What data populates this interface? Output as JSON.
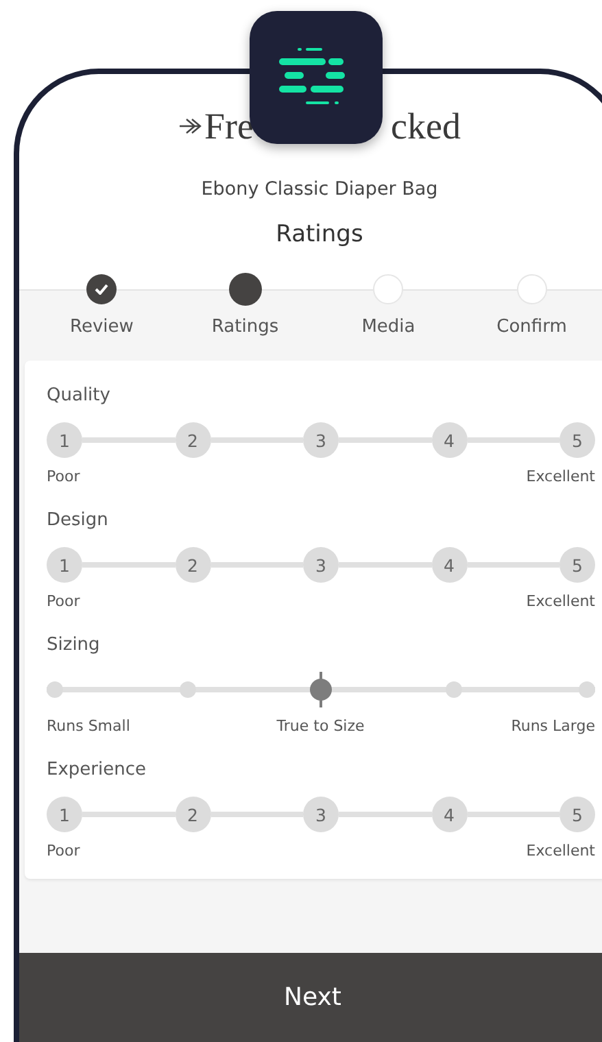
{
  "brand": {
    "parts": [
      "Fre",
      "cked"
    ]
  },
  "product": "Ebony Classic Diaper Bag",
  "heading": "Ratings",
  "steps": [
    {
      "label": "Review",
      "completed": true,
      "selected": false
    },
    {
      "label": "Ratings",
      "completed": false,
      "selected": true
    },
    {
      "label": "Media",
      "completed": false,
      "selected": false
    },
    {
      "label": "Confirm",
      "completed": false,
      "selected": false
    }
  ],
  "ratings": [
    {
      "kind": "numbered",
      "title": "Quality",
      "options": [
        {
          "label": "1",
          "selected": false
        },
        {
          "label": "2",
          "selected": false
        },
        {
          "label": "3",
          "selected": false
        },
        {
          "label": "4",
          "selected": false
        },
        {
          "label": "5",
          "selected": false
        }
      ],
      "low_label": "Poor",
      "high_label": "Excellent"
    },
    {
      "kind": "numbered",
      "title": "Design",
      "options": [
        {
          "label": "1",
          "selected": false
        },
        {
          "label": "2",
          "selected": false
        },
        {
          "label": "3",
          "selected": false
        },
        {
          "label": "4",
          "selected": false
        },
        {
          "label": "5",
          "selected": false
        }
      ],
      "low_label": "Poor",
      "high_label": "Excellent"
    },
    {
      "kind": "slider",
      "title": "Sizing",
      "level": 0.5,
      "low_label": "Runs Small",
      "mid_label": "True to Size",
      "high_label": "Runs Large"
    },
    {
      "kind": "numbered",
      "title": "Experience",
      "options": [
        {
          "label": "1",
          "selected": false
        },
        {
          "label": "2",
          "selected": false
        },
        {
          "label": "3",
          "selected": false
        },
        {
          "label": "4",
          "selected": false
        },
        {
          "label": "5",
          "selected": false
        }
      ],
      "low_label": "Poor",
      "high_label": "Excellent"
    }
  ],
  "next_button": "Next"
}
